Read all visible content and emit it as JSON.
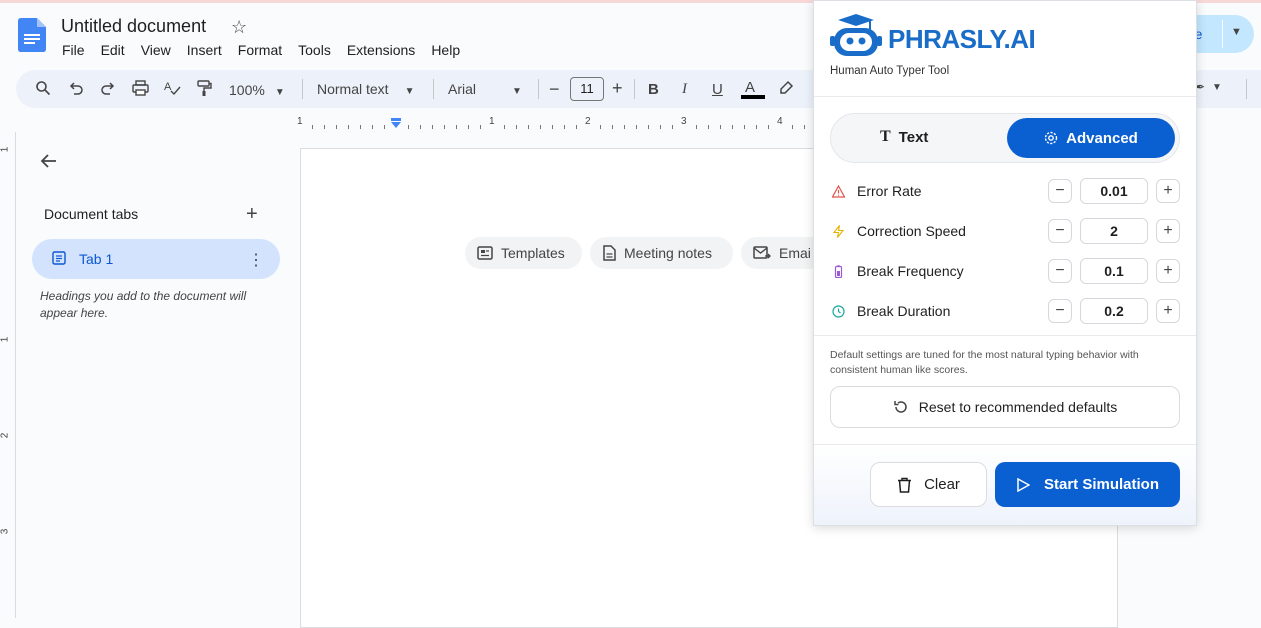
{
  "document": {
    "title": "Untitled document",
    "menu": [
      "File",
      "Edit",
      "View",
      "Insert",
      "Format",
      "Tools",
      "Extensions",
      "Help"
    ]
  },
  "toolbar": {
    "zoom": "100%",
    "style": "Normal text",
    "font": "Arial",
    "font_size": "11"
  },
  "ruler": {
    "numbers": [
      "1",
      "1",
      "2",
      "3",
      "4"
    ],
    "vertical": [
      "1",
      "1",
      "2",
      "3"
    ]
  },
  "left_pane": {
    "title": "Document tabs",
    "tab_label": "Tab 1",
    "hint": "Headings you add to the document will appear here."
  },
  "chips": [
    "Templates",
    "Meeting notes",
    "Emai"
  ],
  "share": {
    "label": "re"
  },
  "extension": {
    "brand": "PHRASLY.AI",
    "subtitle": "Human Auto Typer Tool",
    "tabs": {
      "text": "Text",
      "advanced": "Advanced"
    },
    "settings": [
      {
        "label": "Error Rate",
        "value": "0.01",
        "icon": "warning-icon",
        "color": "#e0554a"
      },
      {
        "label": "Correction Speed",
        "value": "2",
        "icon": "lightning-icon",
        "color": "#e6b400"
      },
      {
        "label": "Break Frequency",
        "value": "0.1",
        "icon": "battery-icon",
        "color": "#9c5ad6"
      },
      {
        "label": "Break Duration",
        "value": "0.2",
        "icon": "clock-icon",
        "color": "#1aa89c"
      }
    ],
    "note": "Default settings are tuned for the most natural typing behavior with consistent human like scores.",
    "reset_label": "Reset to recommended defaults",
    "clear_label": "Clear",
    "start_label": "Start Simulation",
    "accent": "#0a5fd1"
  }
}
